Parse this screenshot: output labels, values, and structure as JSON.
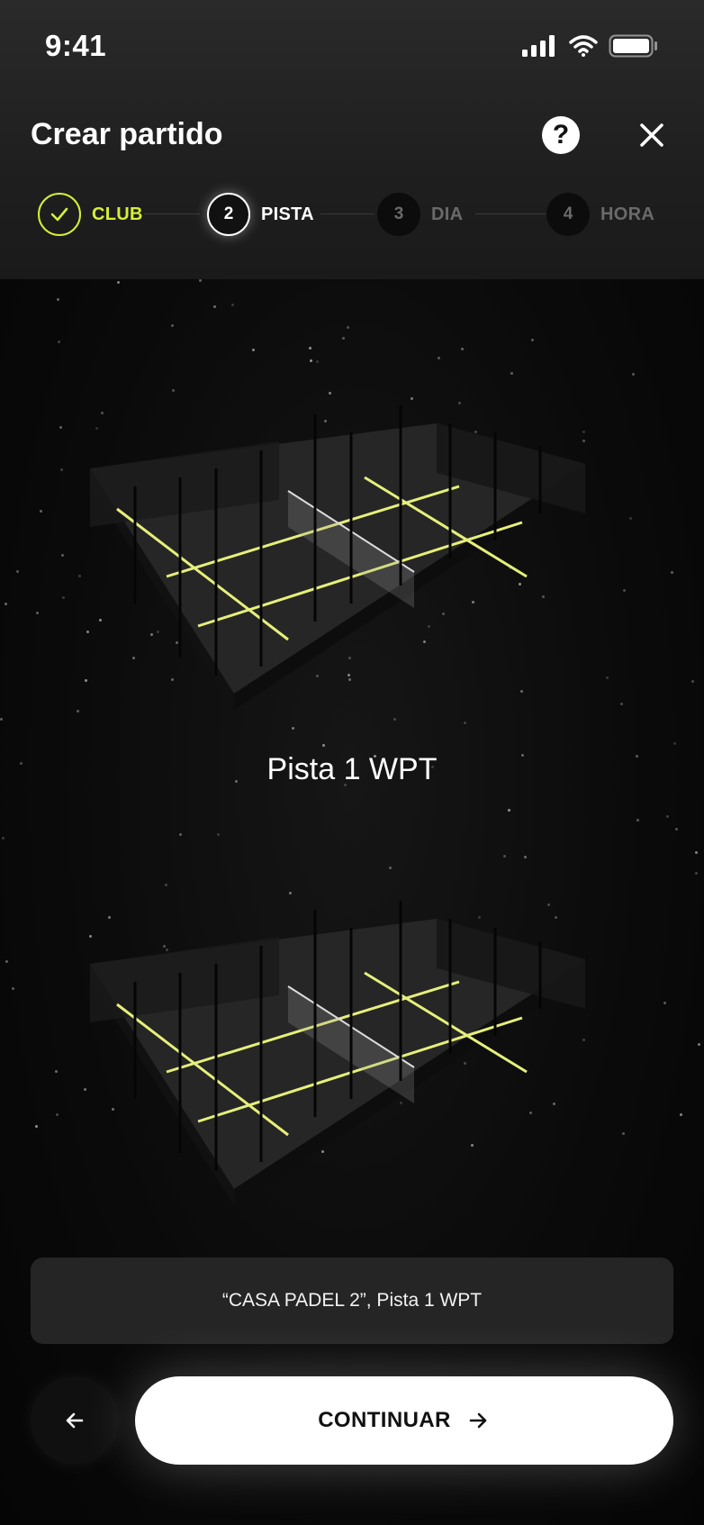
{
  "status_bar": {
    "time": "9:41"
  },
  "header": {
    "title": "Crear partido"
  },
  "stepper": {
    "steps": [
      {
        "number": "",
        "label": "CLUB",
        "state": "done"
      },
      {
        "number": "2",
        "label": "PISTA",
        "state": "active"
      },
      {
        "number": "3",
        "label": "DIA",
        "state": "pending"
      },
      {
        "number": "4",
        "label": "HORA",
        "state": "pending"
      }
    ]
  },
  "court": {
    "name": "Pista 1 WPT"
  },
  "summary": {
    "text": "“CASA PADEL 2”, Pista 1 WPT"
  },
  "actions": {
    "continue_label": "CONTINUAR"
  },
  "colors": {
    "accent": "#d8f034",
    "background": "#070707",
    "header": "#222222"
  },
  "icons": {
    "help": "question-circle-icon",
    "close": "close-icon",
    "check": "check-icon",
    "back": "arrow-left-icon",
    "forward": "arrow-right-icon"
  }
}
